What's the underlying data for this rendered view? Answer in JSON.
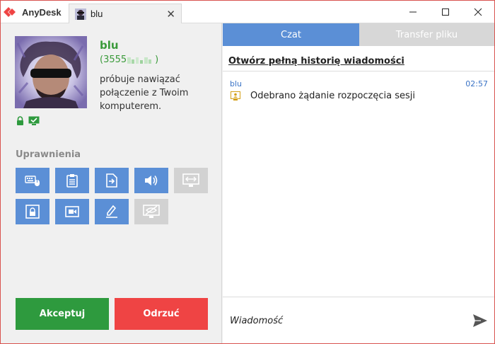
{
  "titlebar": {
    "app_name": "AnyDesk",
    "tab_label": "blu",
    "brand_color": "#ef4444",
    "icons": [
      "anydesk-logo",
      "contact-avatar-icon",
      "close-icon",
      "minimize-icon",
      "maximize-icon",
      "window-close-icon"
    ]
  },
  "contact": {
    "name": "blu",
    "id": "(3555",
    "request_message": "próbuje nawiązać połączenie z Twoim komputerem.",
    "status_icons": [
      "lock-icon",
      "monitor-check-icon"
    ]
  },
  "permissions": {
    "label": "Uprawnienia",
    "items": [
      {
        "icon": "keyboard-mouse-icon",
        "enabled": true
      },
      {
        "icon": "clipboard-icon",
        "enabled": true
      },
      {
        "icon": "file-transfer-icon",
        "enabled": true
      },
      {
        "icon": "sound-icon",
        "enabled": true
      },
      {
        "icon": "monitor-swap-icon",
        "enabled": false
      },
      {
        "icon": "lock-screen-icon",
        "enabled": true
      },
      {
        "icon": "video-record-icon",
        "enabled": true
      },
      {
        "icon": "pen-draw-icon",
        "enabled": true
      },
      {
        "icon": "privacy-mode-icon",
        "enabled": false
      }
    ]
  },
  "actions": {
    "accept_label": "Akceptuj",
    "reject_label": "Odrzuć",
    "accept_color": "#2e9a3e",
    "reject_color": "#ef4444"
  },
  "chat": {
    "tabs": [
      {
        "label": "Czat",
        "active": true
      },
      {
        "label": "Transfer pliku",
        "active": false
      }
    ],
    "history_link": "Otwórz pełną historię wiadomości",
    "messages": [
      {
        "sender": "blu",
        "time": "02:57",
        "text": "Odebrano żądanie rozpoczęcia sesji",
        "icon": "session-request-icon"
      }
    ],
    "input_placeholder": "Wiadomość",
    "accent_color": "#5b8fd6"
  }
}
